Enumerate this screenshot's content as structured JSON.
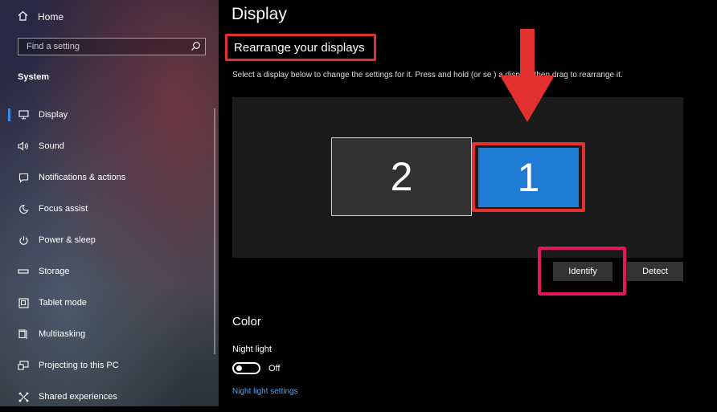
{
  "sidebar": {
    "home_label": "Home",
    "search_placeholder": "Find a setting",
    "section_title": "System",
    "items": [
      {
        "label": "Display",
        "icon": "monitor-icon",
        "active": true
      },
      {
        "label": "Sound",
        "icon": "speaker-icon"
      },
      {
        "label": "Notifications & actions",
        "icon": "notifications-icon"
      },
      {
        "label": "Focus assist",
        "icon": "moon-icon"
      },
      {
        "label": "Power & sleep",
        "icon": "power-icon"
      },
      {
        "label": "Storage",
        "icon": "storage-icon"
      },
      {
        "label": "Tablet mode",
        "icon": "tablet-mode-icon"
      },
      {
        "label": "Multitasking",
        "icon": "multitasking-icon"
      },
      {
        "label": "Projecting to this PC",
        "icon": "projecting-icon"
      },
      {
        "label": "Shared experiences",
        "icon": "shared-experiences-icon"
      }
    ]
  },
  "main": {
    "page_title": "Display",
    "rearrange_title": "Rearrange your displays",
    "instructions": "Select a display below to change the settings for it. Press and hold (or se  ) a display, then drag to rearrange it.",
    "displays": {
      "secondary": "2",
      "primary": "1"
    },
    "identify_label": "Identify",
    "detect_label": "Detect",
    "color_title": "Color",
    "night_light_label": "Night light",
    "night_light_state": "Off",
    "night_light_link": "Night light settings"
  },
  "colors": {
    "accent": "#1f7ad3",
    "highlight_red": "#e2312f",
    "highlight_pink": "#e2185a",
    "link": "#4aa3f0"
  }
}
